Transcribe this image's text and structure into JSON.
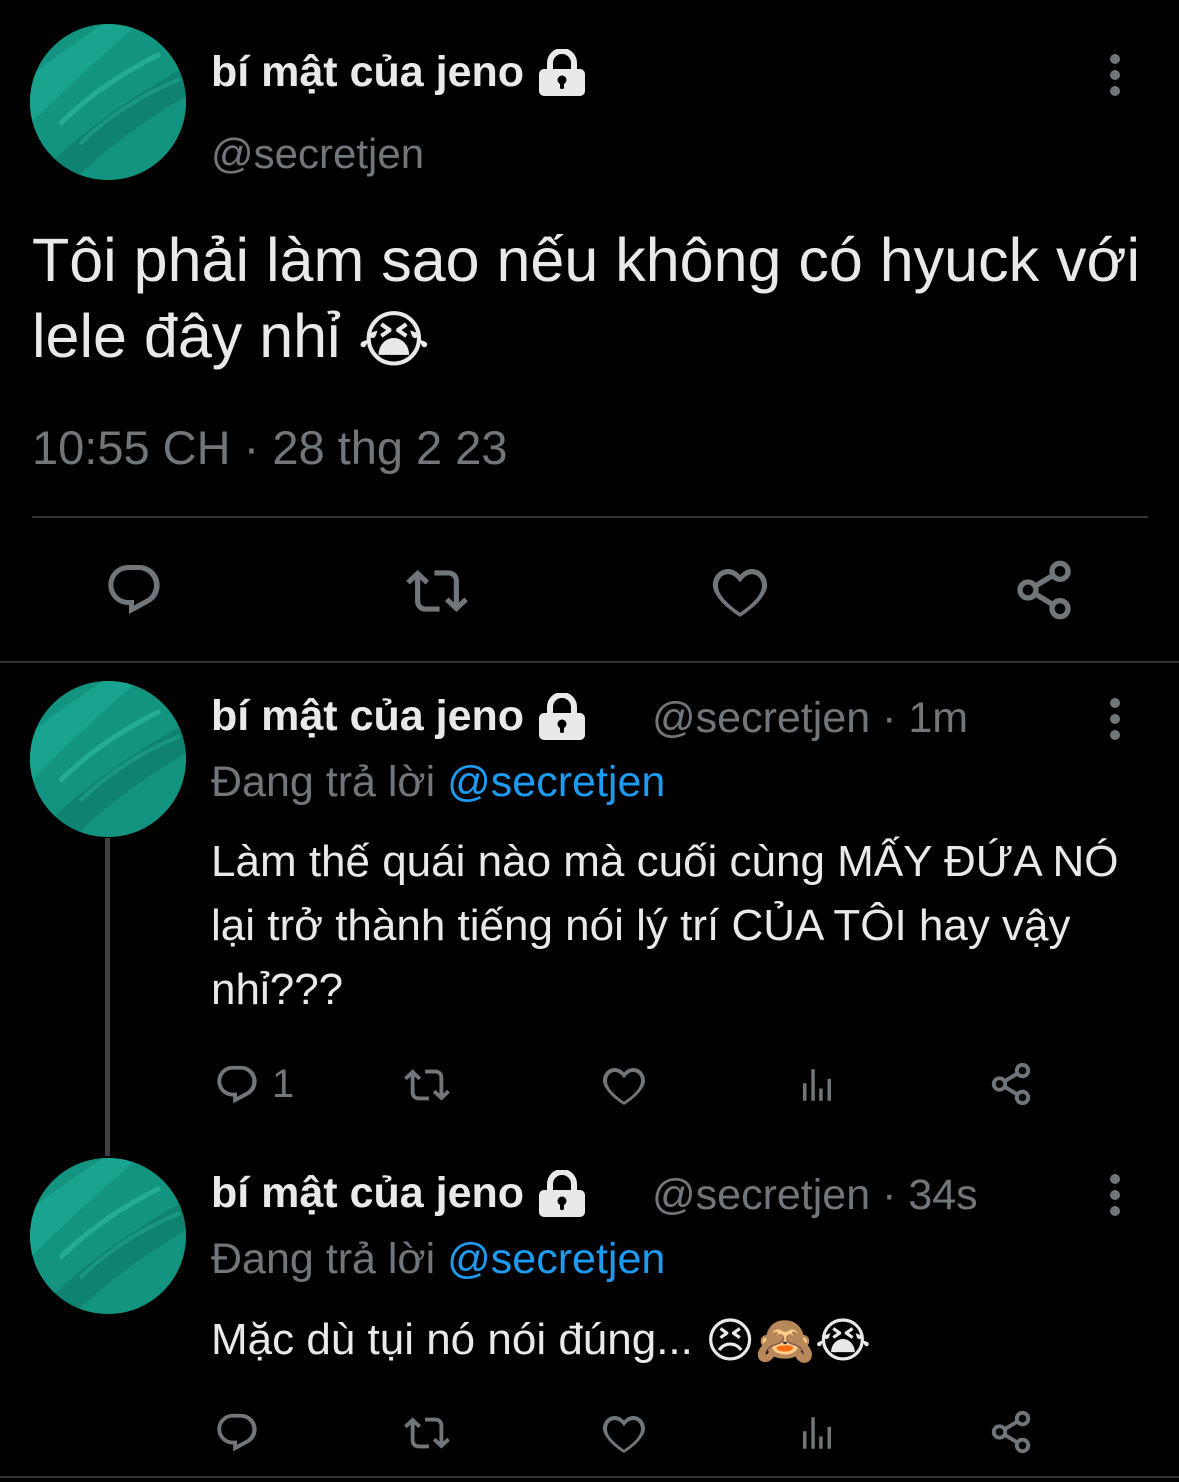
{
  "main_tweet": {
    "display_name": "bí mật của jeno",
    "handle": "@secretjen",
    "text": "Tôi phải làm sao nếu không có hyuck với lele đây nhỉ",
    "emoji": "😭",
    "timestamp": "10:55 CH · 28 thg 2 23",
    "avatar_color": "#17a08a"
  },
  "replies": [
    {
      "display_name": "bí mật của jeno",
      "handle_time": "@secretjen · 1m",
      "replying_prefix": "Đang trả lời",
      "replying_to": "@secretjen",
      "text": "Làm thế quái nào mà cuối cùng MẤY ĐỨA NÓ lại trở thành tiếng nói lý trí CỦA TÔI hay vậy nhỉ???",
      "reply_count": "1"
    },
    {
      "display_name": "bí mật của jeno",
      "handle_time": "@secretjen · 34s",
      "replying_prefix": "Đang trả lời",
      "replying_to": "@secretjen",
      "text": "Mặc dù tụi nó nói đúng...",
      "emojis": [
        "😣",
        "🙈",
        "😭"
      ],
      "reply_count": ""
    }
  ],
  "colors": {
    "background": "#000000",
    "text": "#e7e9ea",
    "muted": "#71767b",
    "link": "#1d9bf0",
    "divider": "#2f3336"
  },
  "icons": [
    "lock-icon",
    "more-vertical-icon",
    "reply-icon",
    "retweet-icon",
    "like-icon",
    "views-icon",
    "share-icon"
  ]
}
